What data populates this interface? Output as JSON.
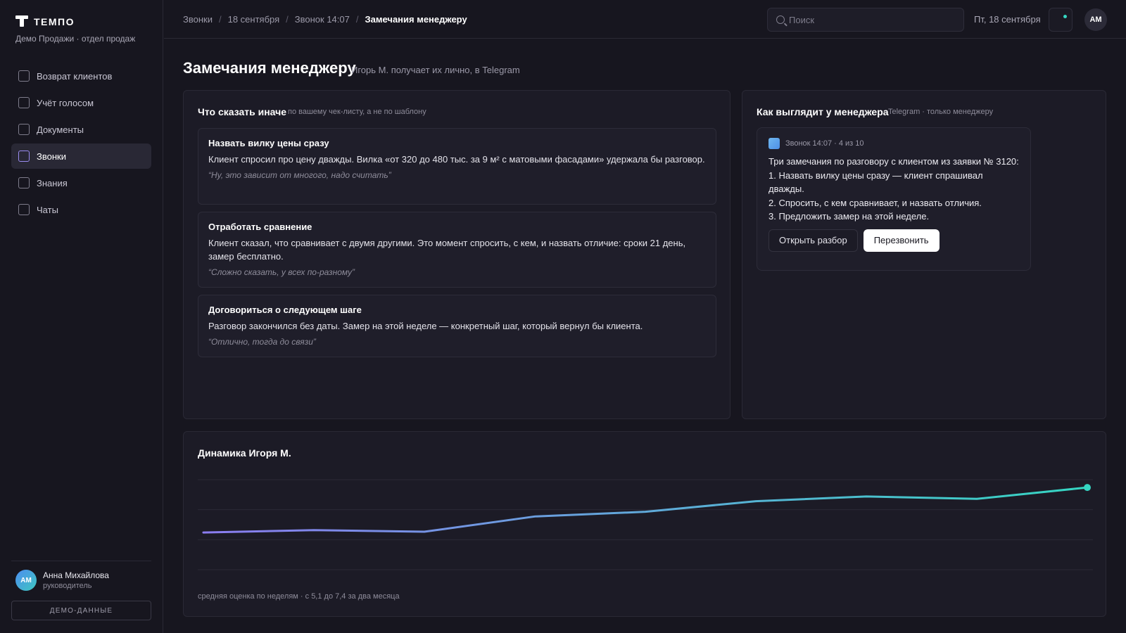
{
  "app": {
    "brand": "ТЕМПО",
    "org": "Демо Продажи · отдел продаж"
  },
  "sidebar": {
    "items": [
      {
        "label": "Возврат клиентов",
        "icon": "square-icon"
      },
      {
        "label": "Учёт голосом",
        "icon": "square-icon"
      },
      {
        "label": "Документы",
        "icon": "square-icon"
      },
      {
        "label": "Звонки",
        "icon": "square-icon",
        "active": true
      },
      {
        "label": "Знания",
        "icon": "square-icon"
      },
      {
        "label": "Чаты",
        "icon": "square-icon"
      }
    ],
    "user": {
      "initials": "АМ",
      "name": "Анна Михайлова",
      "role": "руководитель"
    },
    "demo_label": "ДЕМО-ДАННЫЕ"
  },
  "topbar": {
    "breadcrumbs": [
      "Звонки",
      "18 сентября",
      "Звонок 14:07",
      "Замечания менеджеру"
    ],
    "search_placeholder": "Поиск",
    "date": "Пт, 18 сентября",
    "avatar_initials": "АМ"
  },
  "page": {
    "title": "Замечания менеджеру",
    "subtitle": "Игорь М. получает их лично, в Telegram"
  },
  "notes_card": {
    "title": "Что сказать иначе",
    "hint": "по вашему чек-листу, а не по шаблону",
    "items": [
      {
        "title": "Назвать вилку цены сразу",
        "text": "Клиент спросил про цену дважды. Вилка «от 320 до 480 тыс. за 9 м² с матовыми фасадами» удержала бы разговор.",
        "quote": "“Ну, это зависит от многого, надо считать”"
      },
      {
        "title": "Отработать сравнение",
        "text": "Клиент сказал, что сравнивает с двумя другими. Это момент спросить, с кем, и назвать отличие: сроки 21 день, замер бесплатно.",
        "quote": "“Сложно сказать, у всех по-разному”"
      },
      {
        "title": "Договориться о следующем шаге",
        "text": "Разговор закончился без даты. Замер на этой неделе — конкретный шаг, который вернул бы клиента.",
        "quote": "“Отлично, тогда до связи”"
      }
    ]
  },
  "preview_card": {
    "title": "Как выглядит у менеджера",
    "hint": "Telegram · только менеджеру",
    "message": {
      "meta": "Звонок 14:07 · 4 из 10",
      "lines": [
        "Три замечания по разговору с клиентом из заявки № 3120:",
        "1. Назвать вилку цены сразу — клиент спрашивал дважды.",
        "2. Спросить, с кем сравнивает, и назвать отличия.",
        "3. Предложить замер на этой неделе."
      ],
      "open_button": "Открыть разбор",
      "call_button": "Перезвонить"
    }
  },
  "dynamics_card": {
    "title": "Динамика Игоря М.",
    "caption": "средняя оценка по неделям · с 5,1 до 7,4 за два месяца"
  },
  "chart_data": {
    "type": "line",
    "title": "Динамика Игоря М.",
    "x": [
      1,
      2,
      3,
      4,
      5,
      6,
      7,
      8,
      9
    ],
    "series": [
      {
        "values": [
          5.1,
          5.22,
          5.14,
          5.92,
          6.16,
          6.7,
          6.94,
          6.82,
          7.4
        ]
      }
    ],
    "ylim": [
      3.2,
      7.8
    ],
    "grid": true,
    "colors": {
      "start": "#8b7cf0",
      "end": "#35d6c2"
    }
  }
}
